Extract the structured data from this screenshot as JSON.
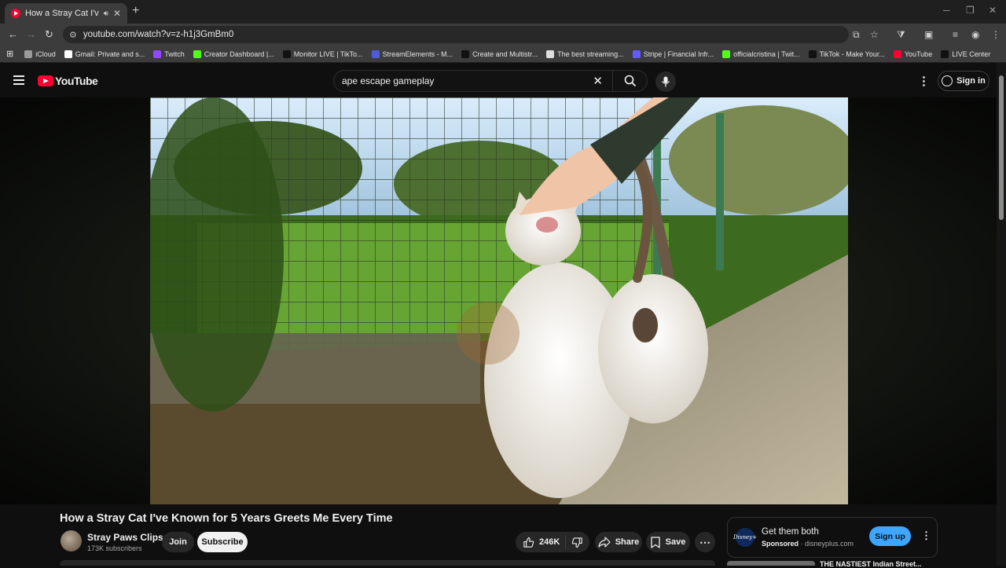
{
  "browser": {
    "tab_title": "How a Stray Cat I've Known",
    "url": "youtube.com/watch?v=z-h1j3GmBm0",
    "new_tab_glyph": "+",
    "bookmarks": [
      {
        "label": "iCloud",
        "color": "#9a9a9a"
      },
      {
        "label": "Gmail: Private and s...",
        "color": "#ffffff"
      },
      {
        "label": "Twitch",
        "color": "#9146ff"
      },
      {
        "label": "Creator Dashboard |...",
        "color": "#53fc18"
      },
      {
        "label": "Monitor LIVE | TikTo...",
        "color": "#111111"
      },
      {
        "label": "StreamElements - M...",
        "color": "#4e5bd6"
      },
      {
        "label": "Create and Multistr...",
        "color": "#111111"
      },
      {
        "label": "The best streaming...",
        "color": "#dddddd"
      },
      {
        "label": "Stripe | Financial Infr...",
        "color": "#635bff"
      },
      {
        "label": "officialcristina | Twit...",
        "color": "#53fc18"
      },
      {
        "label": "TikTok - Make Your...",
        "color": "#111111"
      },
      {
        "label": "YouTube",
        "color": "#ff0033"
      },
      {
        "label": "LIVE Center",
        "color": "#111111"
      }
    ]
  },
  "header": {
    "logo_text": "YouTube",
    "search_query": "ape escape gameplay",
    "signin_label": "Sign in"
  },
  "video": {
    "title": "How a Stray Cat I've Known for 5 Years Greets Me Every Time",
    "channel_name": "Stray Paws Clips",
    "subscribers": "173K subscribers",
    "join_label": "Join",
    "subscribe_label": "Subscribe",
    "likes": "246K",
    "share_label": "Share",
    "save_label": "Save"
  },
  "ad": {
    "title": "Get them both",
    "sponsored": "Sponsored",
    "domain": "disneyplus.com",
    "cta": "Sign up",
    "logo_text": "Disney+"
  },
  "next_video": {
    "title": "THE NASTIEST Indian Street..."
  },
  "colors": {
    "accent": "#ff0033",
    "cta_blue": "#3ea6ff"
  }
}
